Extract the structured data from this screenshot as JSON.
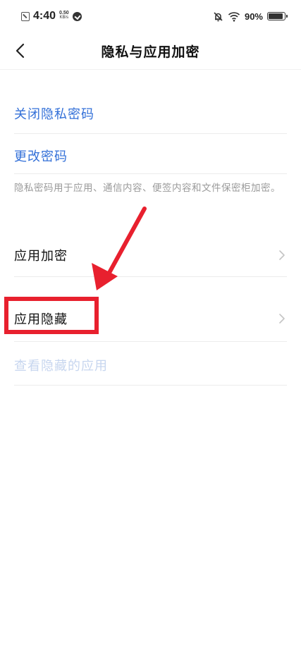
{
  "status_bar": {
    "time": "4:40",
    "speed_value": "0.50",
    "speed_unit": "KB/s",
    "battery_percent": "90%",
    "battery_level": 0.9,
    "icons": [
      "sim-icon",
      "notification-icon",
      "mute-icon",
      "wifi-icon",
      "battery-icon"
    ]
  },
  "header": {
    "title": "隐私与应用加密",
    "back_icon": "chevron-left-icon"
  },
  "items": {
    "close_privacy_password": "关闭隐私密码",
    "change_password": "更改密码",
    "note": "隐私密码用于应用、通信内容、便签内容和文件保密柜加密。",
    "app_encryption": "应用加密",
    "app_hiding": "应用隐藏",
    "view_hidden_apps": "查看隐藏的应用"
  },
  "colors": {
    "link_blue": "#3370d8",
    "disabled_blue": "#c7d6ef",
    "annotation_red": "#e8202e",
    "note_gray": "#9a9a9a"
  }
}
